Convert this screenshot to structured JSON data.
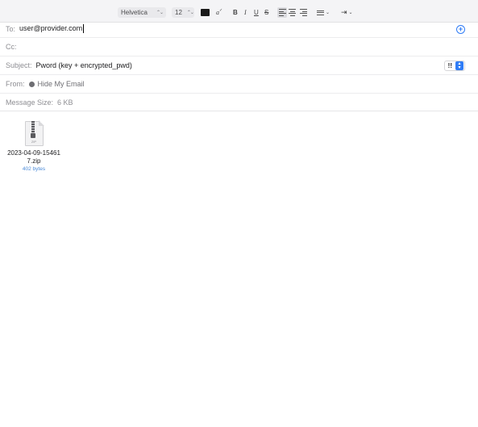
{
  "toolbar": {
    "font_family": "Helvetica",
    "font_size": "12",
    "text_color": "#1a1a1a",
    "glyphs": {
      "highlight": "a",
      "bold": "B",
      "italic": "I",
      "underline": "U",
      "strike": "S"
    }
  },
  "header": {
    "to_label": "To:",
    "to_value": "user@provider.com",
    "cc_label": "Cc:",
    "cc_value": "",
    "subject_label": "Subject:",
    "subject_value": "Pword (key + encrypted_pwd)",
    "priority_value": "!!",
    "from_label": "From:",
    "from_value": "Hide My Email",
    "size_label": "Message Size:",
    "size_value": "6 KB"
  },
  "attachment": {
    "filename": "2023-04-09-154617.zip",
    "size": "402 bytes",
    "icon_text": "ZIP"
  },
  "colors": {
    "accent": "#2f7cf6",
    "link": "#4a8ad8",
    "label": "#8e8e93"
  }
}
